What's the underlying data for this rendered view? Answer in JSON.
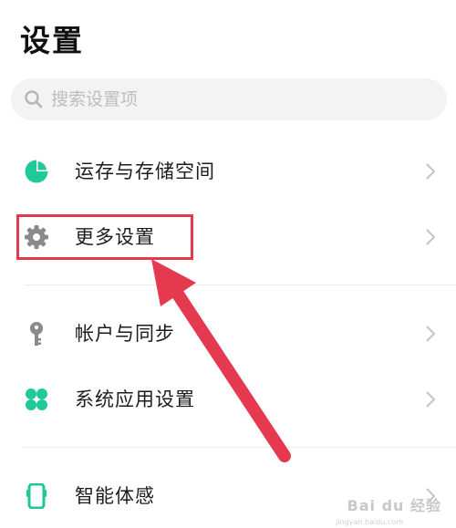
{
  "header": {
    "title": "设置"
  },
  "search": {
    "placeholder": "搜索设置项",
    "icon": "search-icon"
  },
  "settings": [
    {
      "label": "运存与存储空间",
      "icon": "pie-chart-icon",
      "color": "#20c997"
    },
    {
      "label": "更多设置",
      "icon": "gear-icon",
      "color": "#8a8a8a"
    },
    {
      "label": "帐户与同步",
      "icon": "key-icon",
      "color": "#8a8a8a"
    },
    {
      "label": "系统应用设置",
      "icon": "grid-icon",
      "color": "#20c997"
    },
    {
      "label": "智能体感",
      "icon": "phone-icon",
      "color": "#20c997"
    }
  ],
  "annotation": {
    "highlight_color": "#e53950"
  },
  "watermark": {
    "text": "Bai du 经验",
    "sub": "jingyan.baidu.com"
  }
}
